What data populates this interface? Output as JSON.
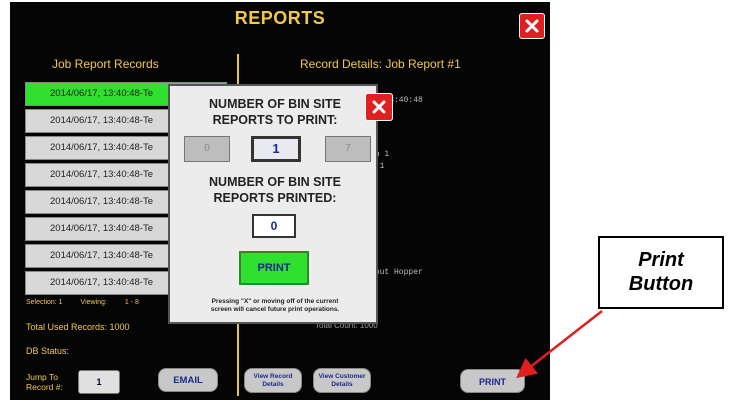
{
  "window": {
    "title": "REPORTS",
    "close_icon": "close-icon"
  },
  "left": {
    "heading": "Job Report Records",
    "records": [
      "2014/06/17, 13:40:48-Te",
      "2014/06/17, 13:40:48-Te",
      "2014/06/17, 13:40:48-Te",
      "2014/06/17, 13:40:48-Te",
      "2014/06/17, 13:40:48-Te",
      "2014/06/17, 13:40:48-Te",
      "2014/06/17, 13:40:48-Te",
      "2014/06/17, 13:40:48-Te"
    ],
    "selected_index": 0,
    "selection_label": "Selection: 1",
    "viewing_label": "Viewing:",
    "viewing_range": "1 - 8",
    "total_used": "Total Used Records: 1000",
    "db_status": "DB Status:",
    "jump_label_1": "Jump To",
    "jump_label_2": "Record #:",
    "jump_value": "1",
    "email_label": "EMAIL"
  },
  "right": {
    "heading": "Record Details: Job Report #1",
    "detail_lines": [
      "17 13:40:48",
      "1",
      "an 1",
      "n 1",
      "nput Hopper"
    ],
    "total_text": "Total Count: 1000",
    "view_record_label_1": "View Record",
    "view_record_label_2": "Details",
    "view_customer_label_1": "View Customer",
    "view_customer_label_2": "Details",
    "print_label": "PRINT"
  },
  "dialog": {
    "title1_line1": "NUMBER OF BIN SITE",
    "title1_line2": "REPORTS TO PRINT:",
    "dec_value": "0",
    "current_value": "1",
    "inc_value": "7",
    "title2_line1": "NUMBER OF BIN SITE",
    "title2_line2": "REPORTS PRINTED:",
    "printed_value": "0",
    "print_label": "PRINT",
    "note_line1": "Pressing \"X\" or moving off of the current",
    "note_line2": "screen will cancel future print operations."
  },
  "callout": {
    "line1": "Print",
    "line2": "Button"
  },
  "colors": {
    "accent": "#f2c84b",
    "selected": "#2fe02f",
    "close": "#e02020",
    "arrow": "#e02020"
  }
}
